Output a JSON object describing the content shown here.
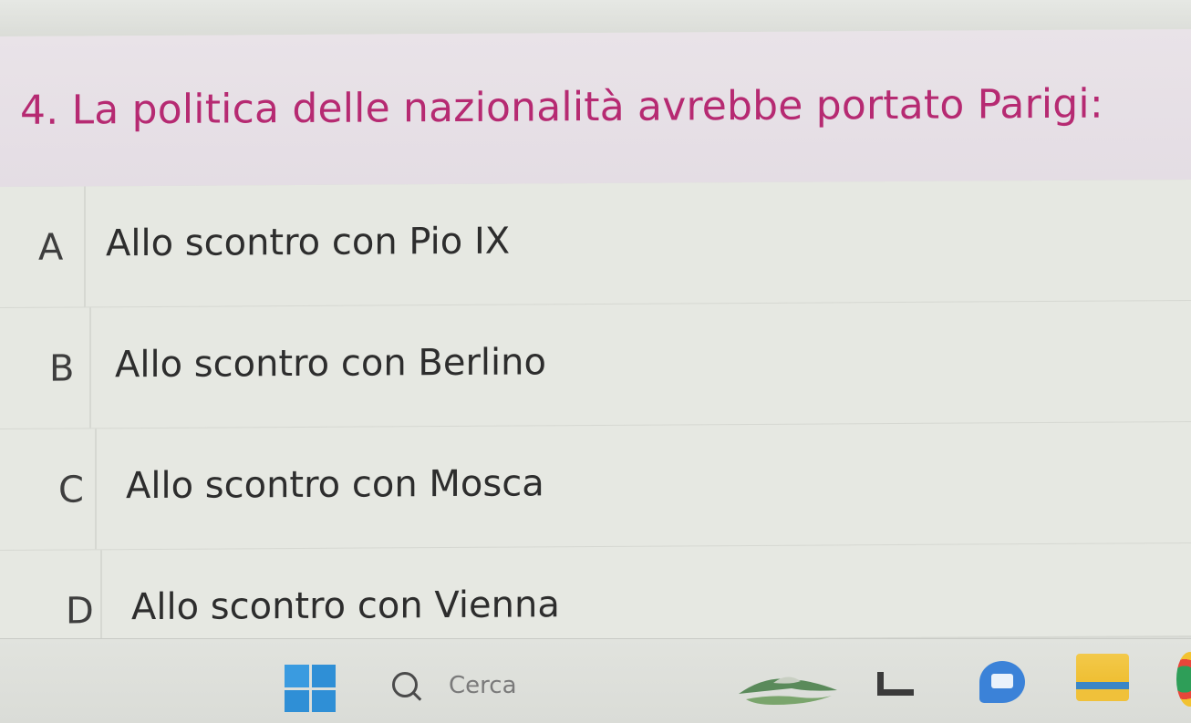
{
  "quiz": {
    "question": "4. La politica delle nazionalità avrebbe portato Parigi:",
    "options": [
      {
        "letter": "A",
        "label": "Allo scontro con Pio IX"
      },
      {
        "letter": "B",
        "label": "Allo scontro con Berlino"
      },
      {
        "letter": "C",
        "label": "Allo scontro con Mosca"
      },
      {
        "letter": "D",
        "label": "Allo scontro con Vienna"
      }
    ]
  },
  "taskbar": {
    "search_placeholder": "Cerca",
    "icons": [
      "start-icon",
      "search-icon",
      "weather-widget-icon",
      "app-icon",
      "chat-icon",
      "file-explorer-icon",
      "chrome-icon"
    ]
  },
  "colors": {
    "question_text": "#b62a72",
    "question_band": "#e9e3e8",
    "option_bg": "#e6e8e2",
    "start_blue": "#2f8fd6"
  }
}
